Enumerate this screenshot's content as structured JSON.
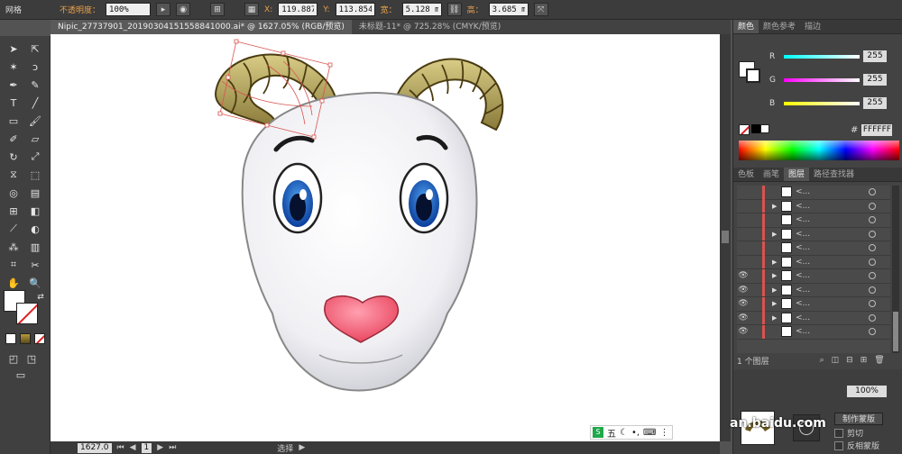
{
  "toolbar": {
    "workspace": "网格",
    "opacity_label": "不透明度：",
    "opacity_value": "100%",
    "x_label": "X:",
    "x_value": "119.887 r",
    "y_label": "Y:",
    "y_value": "113.854 r",
    "w_label": "宽：",
    "w_value": "5.128 mm",
    "h_label": "高：",
    "h_value": "3.685 mm"
  },
  "tabs": [
    {
      "label": "Nipic_27737901_20190304151558841000.ai* @ 1627.05% (RGB/预览)",
      "active": true
    },
    {
      "label": "未标题-11* @ 725.28% (CMYK/预览)",
      "active": false
    }
  ],
  "color_panel": {
    "tabs": [
      "颜色",
      "颜色参考",
      "描边"
    ],
    "channels": [
      {
        "name": "R",
        "value": "255",
        "color": "#00c8e6"
      },
      {
        "name": "G",
        "value": "255",
        "color": "#d020d0"
      },
      {
        "name": "B",
        "value": "255",
        "color": "#e6e600"
      }
    ],
    "hex_label": "#",
    "hex_value": "FFFFFF"
  },
  "layers_panel": {
    "tabs": [
      "色板",
      "画笔",
      "图层",
      "路径查找器"
    ],
    "rows": [
      {
        "eye": false,
        "expand": false,
        "name": "<..."
      },
      {
        "eye": false,
        "expand": true,
        "name": "<..."
      },
      {
        "eye": false,
        "expand": false,
        "name": "<..."
      },
      {
        "eye": false,
        "expand": true,
        "name": "<..."
      },
      {
        "eye": false,
        "expand": false,
        "name": "<..."
      },
      {
        "eye": false,
        "expand": true,
        "name": "<..."
      },
      {
        "eye": true,
        "expand": true,
        "name": "<..."
      },
      {
        "eye": true,
        "expand": true,
        "name": "<..."
      },
      {
        "eye": true,
        "expand": true,
        "name": "<..."
      },
      {
        "eye": true,
        "expand": true,
        "name": "<..."
      },
      {
        "eye": true,
        "expand": false,
        "name": "<..."
      }
    ],
    "footer_count": "1 个图层"
  },
  "bottom_panel": {
    "opacity_value": "100%",
    "make_mask": "制作蒙版",
    "clip": "剪切",
    "invert_mask": "反相蒙版"
  },
  "status": {
    "zoom": "1627.0",
    "page": "1",
    "tool": "选择"
  },
  "watermark": "an.baidu.com",
  "ime": "五"
}
